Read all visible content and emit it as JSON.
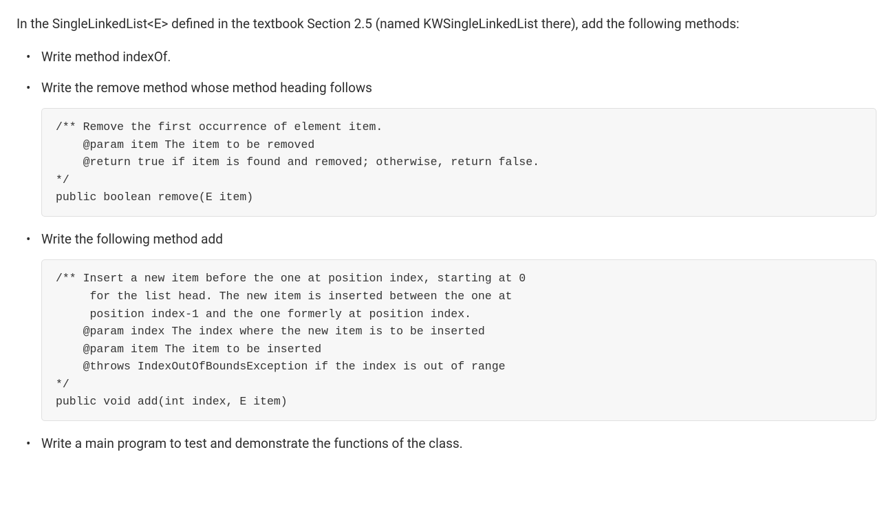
{
  "intro": "In the SingleLinkedList<E> defined in the textbook Section 2.5 (named KWSingleLinkedList there), add the following methods:",
  "bullets": {
    "b1": "Write method indexOf.",
    "b2": "Write the remove method whose method heading follows",
    "b3": "Write the following method add",
    "b4": "Write a main program to test and demonstrate the functions of the class."
  },
  "code1": "/** Remove the first occurrence of element item.\n    @param item The item to be removed\n    @return true if item is found and removed; otherwise, return false.\n*/\npublic boolean remove(E item)",
  "code2": "/** Insert a new item before the one at position index, starting at 0\n     for the list head. The new item is inserted between the one at\n     position index-1 and the one formerly at position index.\n    @param index The index where the new item is to be inserted\n    @param item The item to be inserted\n    @throws IndexOutOfBoundsException if the index is out of range\n*/\npublic void add(int index, E item)"
}
